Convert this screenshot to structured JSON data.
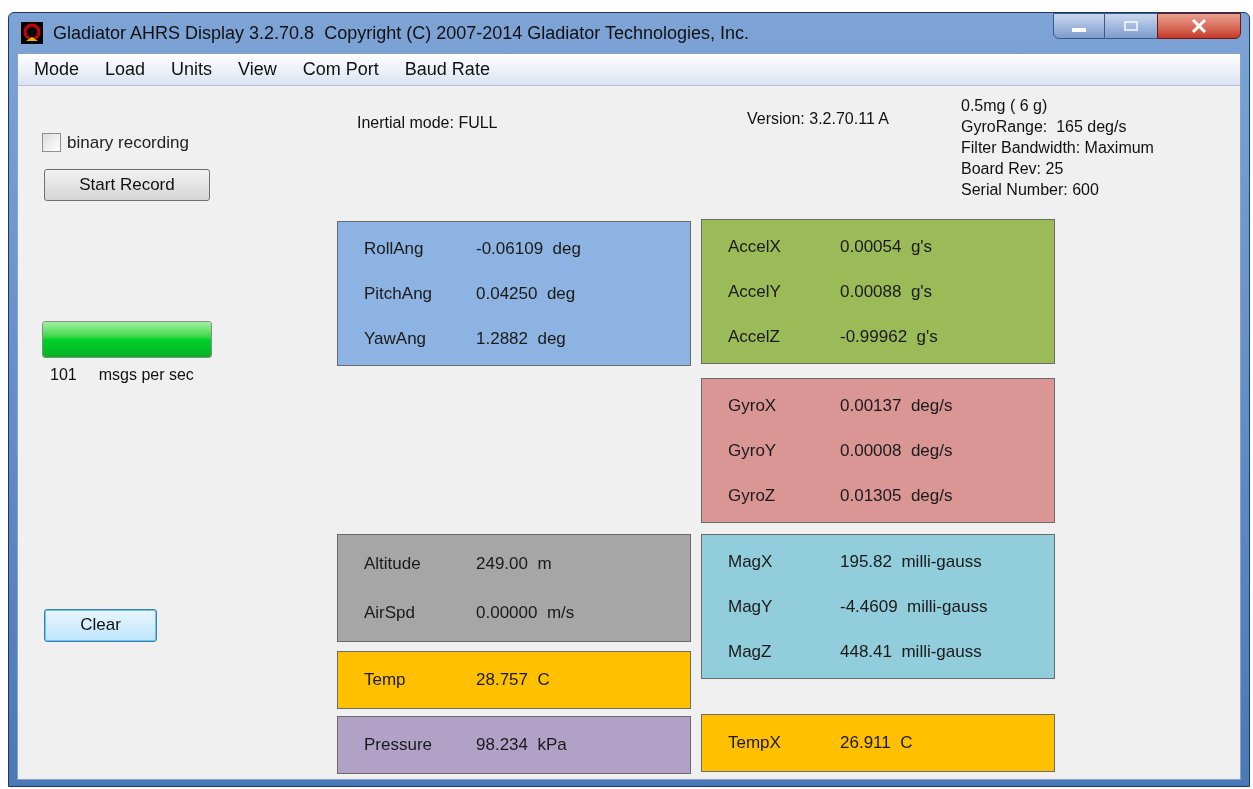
{
  "window": {
    "title": "Gladiator AHRS Display 3.2.70.8  Copyright (C) 2007-2014 Gladiator Technologies, Inc."
  },
  "menu": [
    "Mode",
    "Load",
    "Units",
    "View",
    "Com Port",
    "Baud Rate"
  ],
  "binary_recording": {
    "label": "binary recording",
    "checked": false
  },
  "start_record_button": "Start Record",
  "rate_meter": {
    "level": 1.0,
    "count": "101",
    "unit": "msgs per sec"
  },
  "clear_button": {
    "label": "Clear",
    "focused": true
  },
  "inertial_mode": "Inertial mode: FULL",
  "version": "Version: 3.2.70.11 A",
  "device_info": [
    "0.5mg ( 6 g)",
    "GyroRange:  165 deg/s",
    "Filter Bandwidth: Maximum",
    "Board Rev: 25",
    "Serial Number: 600"
  ],
  "left_panels": [
    {
      "color": "#8db3e2",
      "rows": [
        {
          "label": "RollAng",
          "value": "-0.06109  deg"
        },
        {
          "label": "PitchAng",
          "value": "0.04250  deg"
        },
        {
          "label": "YawAng",
          "value": "1.2882  deg"
        }
      ]
    },
    {
      "color": "#a6a6a6",
      "rows": [
        {
          "label": "Altitude",
          "value": "249.00  m"
        },
        {
          "label": "AirSpd",
          "value": "0.00000  m/s"
        }
      ]
    },
    {
      "color": "#ffc000",
      "rows": [
        {
          "label": "Temp",
          "value": "28.757  C"
        }
      ]
    },
    {
      "color": "#b2a1c7",
      "rows": [
        {
          "label": "Pressure",
          "value": "98.234  kPa"
        }
      ]
    }
  ],
  "right_panels": [
    {
      "color": "#9bbb59",
      "rows": [
        {
          "label": "AccelX",
          "value": "0.00054  g's"
        },
        {
          "label": "AccelY",
          "value": "0.00088  g's"
        },
        {
          "label": "AccelZ",
          "value": "-0.99962  g's"
        }
      ]
    },
    {
      "color": "#d99694",
      "rows": [
        {
          "label": "GyroX",
          "value": "0.00137  deg/s"
        },
        {
          "label": "GyroY",
          "value": "0.00008  deg/s"
        },
        {
          "label": "GyroZ",
          "value": "0.01305  deg/s"
        }
      ]
    },
    {
      "color": "#92cddc",
      "rows": [
        {
          "label": "MagX",
          "value": "195.82  milli-gauss"
        },
        {
          "label": "MagY",
          "value": "-4.4609  milli-gauss"
        },
        {
          "label": "MagZ",
          "value": "448.41  milli-gauss"
        }
      ]
    },
    {
      "color": "#ffc000",
      "rows": [
        {
          "label": "TempX",
          "value": "26.911  C"
        }
      ]
    }
  ]
}
